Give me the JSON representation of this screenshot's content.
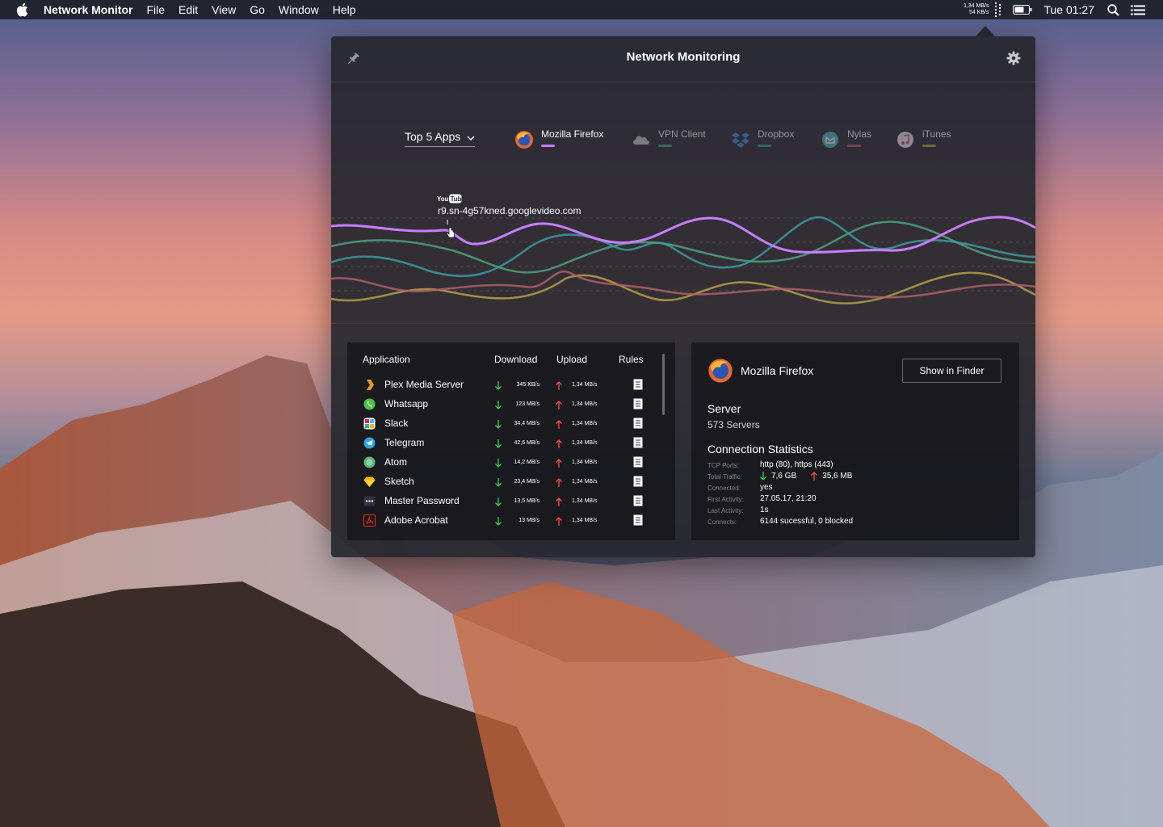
{
  "menubar": {
    "app_name": "Network Monitor",
    "menus": [
      "File",
      "Edit",
      "View",
      "Go",
      "Window",
      "Help"
    ],
    "rate_down": "1,34 MB/s",
    "rate_up": "54 KB/s",
    "clock": "Tue 01:27"
  },
  "window": {
    "title": "Network Monitoring",
    "filter": {
      "label": "Top 5 Apps"
    },
    "apps": [
      {
        "name": "Mozilla Firefox",
        "color": "#c77dff",
        "active": true
      },
      {
        "name": "VPN Client",
        "color": "#4ea37c",
        "active": false
      },
      {
        "name": "Dropbox",
        "color": "#3a9ca4",
        "active": false
      },
      {
        "name": "Nylas",
        "color": "#b0606b",
        "active": false
      },
      {
        "name": "iTunes",
        "color": "#b8a04a",
        "active": false
      }
    ],
    "chart_tooltip": {
      "badge": "YouTube",
      "host": "r9.sn-4g57kned.googlevideo.com"
    },
    "table": {
      "headers": {
        "application": "Application",
        "download": "Download",
        "upload": "Upload",
        "rules": "Rules"
      },
      "rows": [
        {
          "name": "Plex Media Server",
          "icon": "plex-icon",
          "download": "345 KB/s",
          "upload": "1,34 MB/s"
        },
        {
          "name": "Whatsapp",
          "icon": "whatsapp-icon",
          "download": "123 MB/s",
          "upload": "1,34 MB/s"
        },
        {
          "name": "Slack",
          "icon": "slack-icon",
          "download": "34,4 MB/s",
          "upload": "1,34 MB/s"
        },
        {
          "name": "Telegram",
          "icon": "telegram-icon",
          "download": "42,6 MB/s",
          "upload": "1,34 MB/s"
        },
        {
          "name": "Atom",
          "icon": "atom-icon",
          "download": "14,2 MB/s",
          "upload": "1,34 MB/s"
        },
        {
          "name": "Sketch",
          "icon": "sketch-icon",
          "download": "23,4 MB/s",
          "upload": "1,34 MB/s"
        },
        {
          "name": "Master Password",
          "icon": "master-password-icon",
          "download": "13,5 MB/s",
          "upload": "1,34 MB/s"
        },
        {
          "name": "Adobe Acrobat",
          "icon": "adobe-acrobat-icon",
          "download": "13 MB/s",
          "upload": "1,34 MB/s"
        }
      ]
    },
    "detail": {
      "app_name": "Mozilla Firefox",
      "show_in_finder": "Show in Finder",
      "server_heading": "Server",
      "server_count": "573 Servers",
      "stats_heading": "Connection Statistics",
      "stats": {
        "tcp_ports_label": "TCP Ports:",
        "tcp_ports": "http (80), https (443)",
        "total_traffic_label": "Total Traffic:",
        "traffic_down": "7,6 GB",
        "traffic_up": "35,6 MB",
        "connected_label": "Connected:",
        "connected": "yes",
        "first_activity_label": "First Activity:",
        "first_activity": "27.05.17, 21:20",
        "last_activity_label": "Last Activity:",
        "last_activity": "1s",
        "connects_label": "Connects:",
        "connects": "6144 sucessful, 0 blocked"
      }
    }
  },
  "colors": {
    "download_arrow": "#3ad24a",
    "upload_arrow": "#ff4a4a"
  }
}
